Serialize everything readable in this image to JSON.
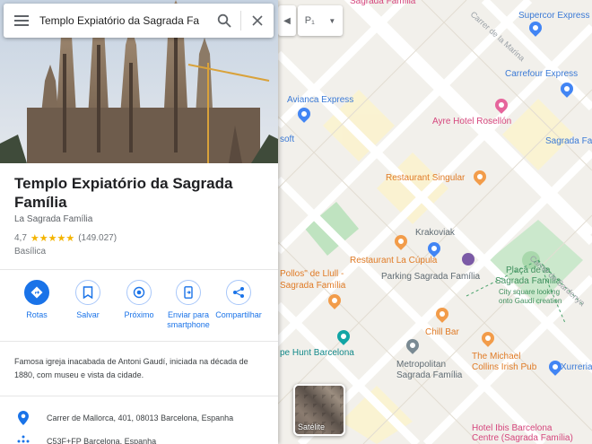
{
  "search": {
    "query": "Templo Expiatório da Sagrada Fa"
  },
  "map_controls": {
    "layers_label": "P₁",
    "satellite_label": "Satélite"
  },
  "place": {
    "title": "Templo Expiatório da Sagrada Família",
    "subtitle": "La Sagrada Família",
    "rating": "4,7",
    "stars": "★★★★★",
    "reviews": "(149.027)",
    "category": "Basílica",
    "description": "Famosa igreja inacabada de Antoni Gaudí, iniciada na década de 1880, com museu e vista da cidade.",
    "address": "Carrer de Mallorca, 401, 08013 Barcelona, Espanha",
    "plus_code": "C53F+FP Barcelona, Espanha"
  },
  "actions": [
    {
      "label": "Rotas",
      "icon": "directions-icon"
    },
    {
      "label": "Salvar",
      "icon": "bookmark-icon"
    },
    {
      "label": "Próximo",
      "icon": "nearby-icon"
    },
    {
      "label": "Enviar para smartphone",
      "icon": "send-to-phone-icon"
    },
    {
      "label": "Compartilhar",
      "icon": "share-icon"
    }
  ],
  "map_labels": {
    "supercor": "Supercor Express",
    "carrefour": "Carrefour Express",
    "avianca": "Avianca Express",
    "ayre": "Ayre Hotel Rosellón",
    "sagrada_fa": "Sagrada Fa",
    "singular": "Restaurant Singular",
    "krakoviak": "Krakoviak",
    "cupula": "Restaurant La Cúpula",
    "parking": "Parking Sagrada Família",
    "pollos": "Pollos\" de Llull -",
    "pollos2": "Sagrada Família",
    "placa1": "Plaça de la",
    "placa2": "Sagrada Família",
    "placa_sub1": "City square looking",
    "placa_sub2": "onto Gaudí creation",
    "chill": "Chill Bar",
    "hunt": "pe Hunt Barcelona",
    "metro1": "Metropolitan",
    "metro2": "Sagrada Família",
    "michael1": "The Michael",
    "michael2": "Collins Irish Pub",
    "xurreria": "Xurreria",
    "ibis1": "Hotel Ibis Barcelona",
    "ibis2": "Centre (Sagrada Família)",
    "street_sard": "Carrer de Sardenya",
    "street_marina": "Carrer de la Marina",
    "soft": "soft",
    "sagrada_top": "Sagrada Família"
  },
  "colors": {
    "accent": "#1a73e8",
    "star": "#f4b400"
  }
}
